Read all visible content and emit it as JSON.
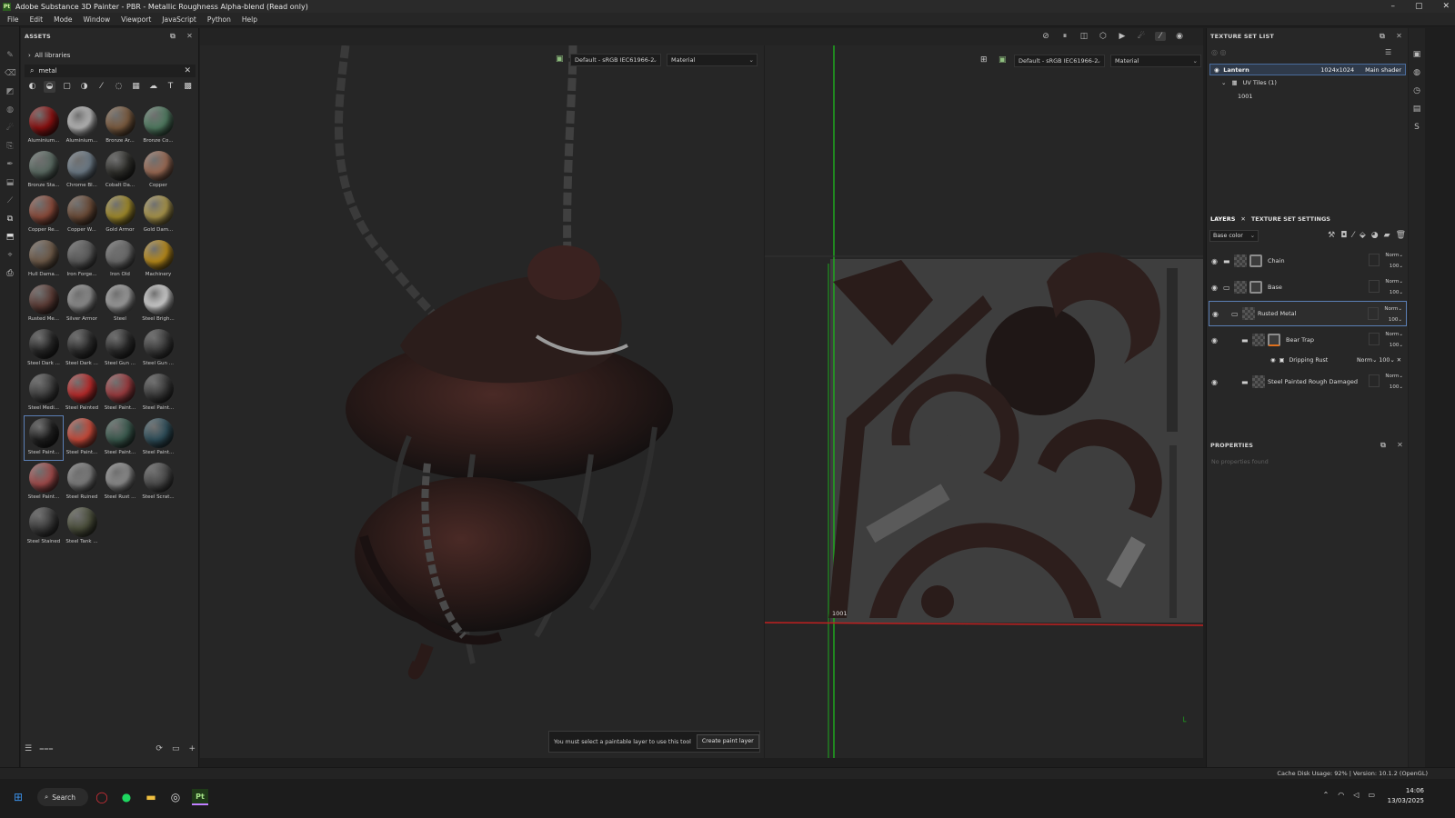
{
  "app": {
    "title": "Adobe Substance 3D Painter - PBR - Metallic Roughness Alpha-blend (Read only)",
    "logo_text": "Pt",
    "window_controls": [
      "–",
      "▢",
      "✕"
    ]
  },
  "menu": [
    "File",
    "Edit",
    "Mode",
    "Window",
    "Viewport",
    "JavaScript",
    "Python",
    "Help"
  ],
  "assets": {
    "title": "ASSETS",
    "library": "All libraries",
    "search_value": "metal",
    "materials": [
      {
        "label": "Aluminium...",
        "color": "#8a1010"
      },
      {
        "label": "Aluminium...",
        "color": "#b7b7b7"
      },
      {
        "label": "Bronze Ar...",
        "color": "#7a5a3e"
      },
      {
        "label": "Bronze Co...",
        "color": "#4f7a60"
      },
      {
        "label": "Bronze Sta...",
        "color": "#5a6a62"
      },
      {
        "label": "Chrome Bl...",
        "color": "#6c7a86"
      },
      {
        "label": "Cobalt Da...",
        "color": "#2e2e2a"
      },
      {
        "label": "Copper",
        "color": "#9a6a54"
      },
      {
        "label": "Copper Re...",
        "color": "#8a4a3a"
      },
      {
        "label": "Copper W...",
        "color": "#6a4a36"
      },
      {
        "label": "Gold Armor",
        "color": "#a08a2a"
      },
      {
        "label": "Gold Dam...",
        "color": "#a8944a"
      },
      {
        "label": "Hull Dama...",
        "color": "#6e5a48"
      },
      {
        "label": "Iron Forge...",
        "color": "#5a5a5a"
      },
      {
        "label": "Iron Old",
        "color": "#6a6a6a"
      },
      {
        "label": "Machinery",
        "color": "#b88a1a"
      },
      {
        "label": "Rusted Me...",
        "color": "#5a3a34"
      },
      {
        "label": "Silver Armor",
        "color": "#8a8a8a"
      },
      {
        "label": "Steel",
        "color": "#9a9a9a"
      },
      {
        "label": "Steel Brigh...",
        "color": "#cfcfcf"
      },
      {
        "label": "Steel Dark ...",
        "color": "#262626"
      },
      {
        "label": "Steel Dark ...",
        "color": "#2c2c2c"
      },
      {
        "label": "Steel Gun ...",
        "color": "#2a2a2a"
      },
      {
        "label": "Steel Gun ...",
        "color": "#3a3a3a"
      },
      {
        "label": "Steel Medi...",
        "color": "#3e3e3e"
      },
      {
        "label": "Steel Painted",
        "color": "#b82a2a"
      },
      {
        "label": "Steel Paint...",
        "color": "#9a3a3e"
      },
      {
        "label": "Steel Paint...",
        "color": "#3a3a3a"
      },
      {
        "label": "Steel Paint...",
        "color": "#1e1e1e"
      },
      {
        "label": "Steel Paint...",
        "color": "#c84a3a"
      },
      {
        "label": "Steel Paint...",
        "color": "#3a5a4e"
      },
      {
        "label": "Steel Paint...",
        "color": "#2e4e5a"
      },
      {
        "label": "Steel Paint...",
        "color": "#a04a4a"
      },
      {
        "label": "Steel Ruined",
        "color": "#7a7a7a"
      },
      {
        "label": "Steel Rust ...",
        "color": "#8a8a8a"
      },
      {
        "label": "Steel Scrat...",
        "color": "#4a4a4a"
      },
      {
        "label": "Steel Stained",
        "color": "#3a3a3a"
      },
      {
        "label": "Steel Tank ...",
        "color": "#4a4e3a"
      }
    ],
    "selected_index": 28
  },
  "viewport": {
    "left_colorspace": "Default - sRGB IEC61966-2",
    "left_mode": "Material",
    "right_colorspace": "Default - sRGB IEC61966-2",
    "right_mode": "Material",
    "uv_tile_label": "1001",
    "notice": "You must select a paintable layer to use this tool",
    "notice_button": "Create paint layer"
  },
  "texture_set_list": {
    "title": "TEXTURE SET LIST",
    "name": "Lantern",
    "resolution": "1024x1024",
    "shader": "Main shader",
    "uv_tiles": "UV Tiles (1)",
    "tile": "1001"
  },
  "layers_panel": {
    "tab_layers": "LAYERS",
    "tab_settings": "TEXTURE SET SETTINGS",
    "channel": "Base color",
    "layers": [
      {
        "name": "Chain",
        "blend": "Norm",
        "opacity": "100"
      },
      {
        "name": "Base",
        "blend": "Norm",
        "opacity": "100"
      },
      {
        "name": "Rusted Metal",
        "blend": "Norm",
        "opacity": "100"
      },
      {
        "name": "Bear Trap",
        "blend": "Norm",
        "opacity": "100"
      },
      {
        "name": "Steel Painted Rough Damaged",
        "blend": "Norm",
        "opacity": "100"
      }
    ],
    "effect": {
      "name": "Dripping Rust",
      "blend": "Norm",
      "opacity": "100"
    }
  },
  "properties": {
    "title": "PROPERTIES",
    "empty": "No properties found"
  },
  "status": {
    "text": "Cache Disk Usage:  92% | Version: 10.1.2 (OpenGL)"
  },
  "taskbar": {
    "search": "Search",
    "time": "14:06",
    "date": "13/03/2025",
    "app_label": "Pt"
  }
}
